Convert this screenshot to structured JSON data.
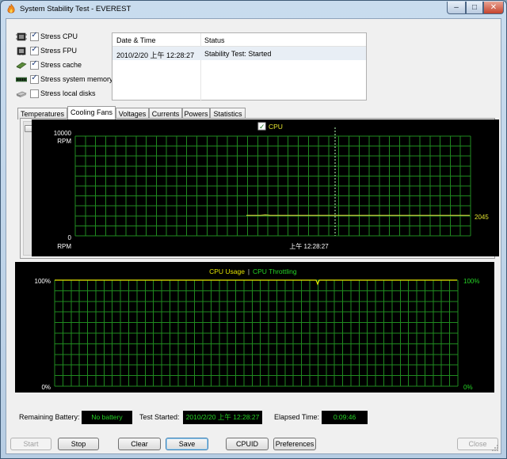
{
  "window": {
    "title": "System Stability Test - EVEREST",
    "controls": {
      "minimize": "–",
      "maximize": "□",
      "close": "✕"
    }
  },
  "stress_options": [
    {
      "icon": "cpu-chip-icon",
      "label": "Stress CPU",
      "checked": true
    },
    {
      "icon": "fpu-chip-icon",
      "label": "Stress FPU",
      "checked": true
    },
    {
      "icon": "cache-icon",
      "label": "Stress cache",
      "checked": true
    },
    {
      "icon": "memory-module-icon",
      "label": "Stress system memory",
      "checked": true
    },
    {
      "icon": "disk-drive-icon",
      "label": "Stress local disks",
      "checked": false
    }
  ],
  "log": {
    "columns": [
      "Date & Time",
      "Status"
    ],
    "rows": [
      {
        "datetime": "2010/2/20 上午 12:28:27",
        "status": "Stability Test: Started"
      }
    ]
  },
  "tabs": [
    {
      "label": "Temperatures",
      "active": false
    },
    {
      "label": "Cooling Fans",
      "active": true
    },
    {
      "label": "Voltages",
      "active": false
    },
    {
      "label": "Currents",
      "active": false
    },
    {
      "label": "Powers",
      "active": false
    },
    {
      "label": "Statistics",
      "active": false
    }
  ],
  "fan_graph": {
    "legend": "CPU",
    "legend_checked": true,
    "y_max_label": "10000",
    "y_min_label": "0",
    "unit": "RPM",
    "time_label": "上午 12:28:27",
    "current_value": "2045",
    "y_max": 10000,
    "y_min": 0,
    "value": 2045,
    "colors": {
      "grid": "#1f8a1f",
      "line": "#d8d840",
      "text": "#ffffff",
      "marker": "#b8ffb8"
    }
  },
  "usage_graph": {
    "legend_usage": "CPU Usage",
    "legend_sep": "|",
    "legend_throttling": "CPU Throttling",
    "left_top": "100%",
    "left_bottom": "0%",
    "right_top": "100%",
    "right_bottom": "0%",
    "usage_percent": 100,
    "colors": {
      "usage": "#e8e800",
      "throttling": "#25d325",
      "grid": "#1f8a1f"
    }
  },
  "status": {
    "battery_label": "Remaining Battery:",
    "battery_value": "No battery",
    "started_label": "Test Started:",
    "started_value": "2010/2/20 上午 12:28:27",
    "elapsed_label": "Elapsed Time:",
    "elapsed_value": "0:09:46"
  },
  "buttons": {
    "start": "Start",
    "stop": "Stop",
    "clear": "Clear",
    "save": "Save",
    "cpuid": "CPUID",
    "preferences": "Preferences",
    "close": "Close"
  }
}
